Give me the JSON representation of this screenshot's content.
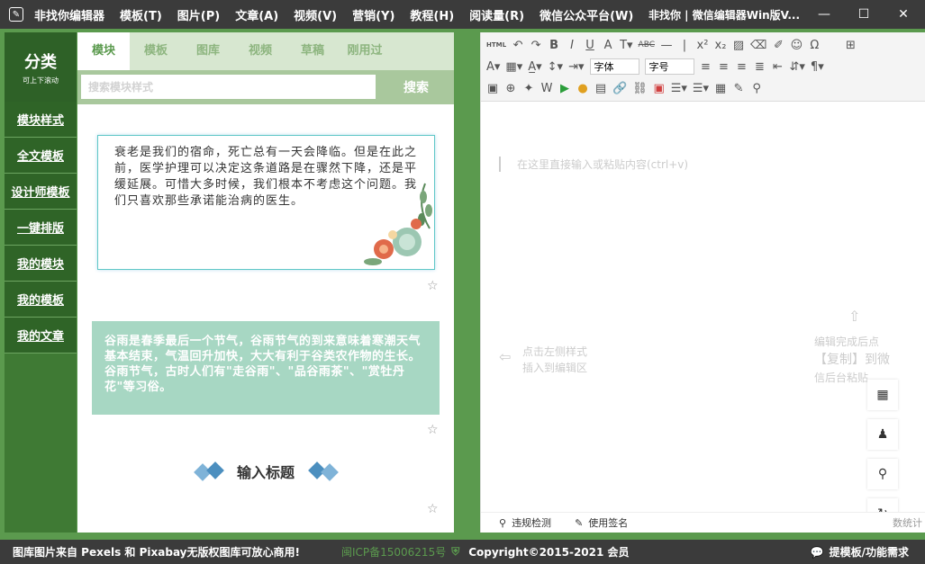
{
  "menu": [
    "非找你编辑器",
    "模板(T)",
    "图片(P)",
    "文章(A)",
    "视频(V)",
    "营销(Y)",
    "教程(H)",
    "阅读量(R)",
    "微信公众平台(W)"
  ],
  "window_title": "非找你 | 微信编辑器Win版V...",
  "category": {
    "title": "分类",
    "subtitle": "可上下滚动",
    "items": [
      "模块样式",
      "全文模板",
      "设计师模板",
      "一键排版",
      "我的模块",
      "我的模板",
      "我的文章"
    ]
  },
  "tabs": [
    "模块",
    "模板",
    "图库",
    "视频",
    "草稿",
    "刚用过"
  ],
  "search": {
    "placeholder": "搜索模块样式",
    "button": "搜索"
  },
  "cards": {
    "card1_text": "衰老是我们的宿命，死亡总有一天会降临。但是在此之前，医学护理可以决定这条道路是在骤然下降，还是平缓延展。可惜大多时候，我们根本不考虑这个问题。我们只喜欢那些承诺能治病的医生。",
    "card2_text": "谷雨是春季最后一个节气，谷雨节气的到来意味着寒潮天气基本结束，气温回升加快，大大有利于谷类农作物的生长。谷雨节气，古时人们有\"走谷雨\"、\"品谷雨茶\"、\"赏牡丹花\"等习俗。",
    "title_template": "输入标题"
  },
  "editor": {
    "font_select": "字体",
    "size_select": "字号",
    "placeholder": "在这里直接输入或粘贴内容(ctrl+v)",
    "hint_left_1": "点击左侧样式",
    "hint_left_2": "插入到编辑区",
    "hint_right_1": "编辑完成后点",
    "hint_right_2": "【复制】到微",
    "hint_right_3": "信后台粘贴",
    "status_check": "违规检测",
    "status_sign": "使用签名",
    "status_count": "数统计"
  },
  "footer": {
    "left": "图库图片来自 Pexels 和 Pixabay无版权图库可放心商用!",
    "icp": "闽ICP备15006215号",
    "copyright": "Copyright©2015-2021 会员",
    "feedback": "提模板/功能需求"
  },
  "colors": {
    "accent": "#5b9a4e",
    "card2_bg": "#a7d7c3"
  }
}
